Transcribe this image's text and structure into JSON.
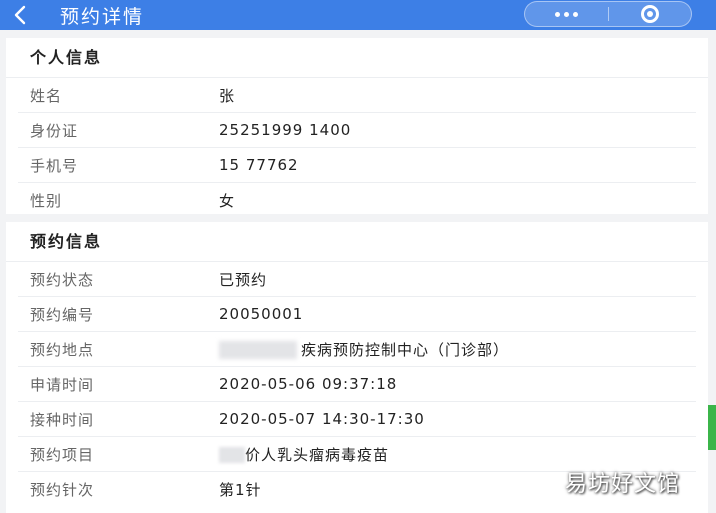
{
  "header": {
    "title": "预约详情",
    "back_icon": "chevron-left-icon",
    "more_icon": "ellipsis-icon",
    "close_icon": "target-circle-icon",
    "color": "#3d7fe6"
  },
  "personal": {
    "section_title": "个人信息",
    "rows": [
      {
        "label": "姓名",
        "value": "张"
      },
      {
        "label": "身份证",
        "value": "25251999 1400"
      },
      {
        "label": "手机号",
        "value": "15 77762"
      },
      {
        "label": "性别",
        "value": "女"
      }
    ]
  },
  "appointment": {
    "section_title": "预约信息",
    "rows": [
      {
        "label": "预约状态",
        "value": "已预约"
      },
      {
        "label": "预约编号",
        "value": "20050001"
      },
      {
        "label": "预约地点",
        "value": "疾病预防控制中心（门诊部）"
      },
      {
        "label": "申请时间",
        "value": "2020-05-06 09:37:18"
      },
      {
        "label": "接种时间",
        "value": "2020-05-07 14:30-17:30"
      },
      {
        "label": "预约项目",
        "value": "价人乳头瘤病毒疫苗"
      },
      {
        "label": "预约针次",
        "value": "第1针"
      }
    ]
  },
  "watermark": "易坊好文馆"
}
